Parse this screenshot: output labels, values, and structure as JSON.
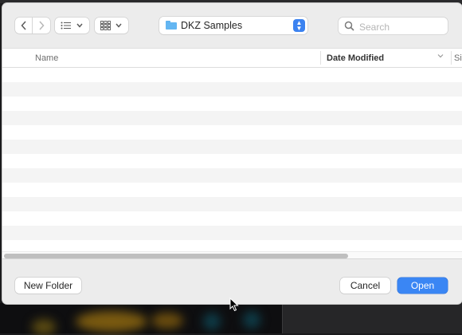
{
  "toolbar": {
    "back_icon": "chevron-left-icon",
    "forward_icon": "chevron-right-icon",
    "list_view_icon": "list-icon",
    "grid_view_icon": "grid-icon",
    "location": {
      "label": "DKZ Samples",
      "icon": "folder-icon"
    },
    "search": {
      "placeholder": "Search"
    }
  },
  "file_list": {
    "columns": [
      {
        "label": "Name"
      },
      {
        "label": "Date Modified",
        "sorted": true
      },
      {
        "label": "Si"
      }
    ],
    "rows": []
  },
  "footer": {
    "new_folder_label": "New Folder",
    "cancel_label": "Cancel",
    "open_label": "Open"
  },
  "colors": {
    "accent": "#3a86f4",
    "folder": "#63b6f2"
  }
}
